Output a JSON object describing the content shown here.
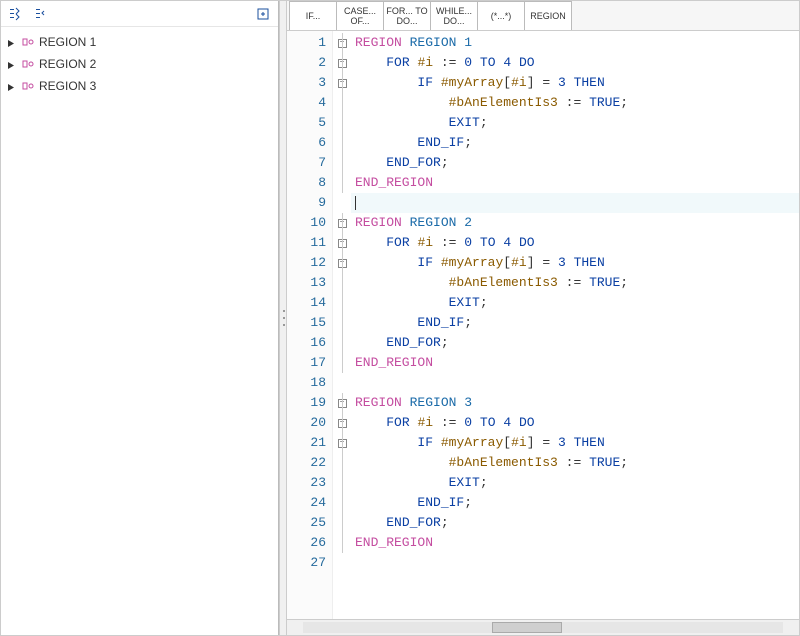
{
  "sidebar": {
    "items": [
      {
        "label": "REGION 1"
      },
      {
        "label": "REGION 2"
      },
      {
        "label": "REGION 3"
      }
    ]
  },
  "snippets": [
    {
      "label": "IF..."
    },
    {
      "label": "CASE... OF..."
    },
    {
      "label": "FOR... TO DO..."
    },
    {
      "label": "WHILE... DO..."
    },
    {
      "label": "(*...*)"
    },
    {
      "label": "REGION"
    }
  ],
  "code": {
    "lines": [
      {
        "n": 1,
        "fold": "open",
        "tokens": [
          [
            "kw-region",
            "REGION"
          ],
          [
            "sp",
            " "
          ],
          [
            "kw-name",
            "REGION 1"
          ]
        ]
      },
      {
        "n": 2,
        "fold": "open",
        "indent": 1,
        "tokens": [
          [
            "kw-ctrl",
            "FOR"
          ],
          [
            "sp",
            " "
          ],
          [
            "kw-var",
            "#i"
          ],
          [
            "sp",
            " "
          ],
          [
            "kw-assign",
            ":="
          ],
          [
            "sp",
            " "
          ],
          [
            "kw-num",
            "0"
          ],
          [
            "sp",
            " "
          ],
          [
            "kw-ctrl",
            "TO"
          ],
          [
            "sp",
            " "
          ],
          [
            "kw-num",
            "4"
          ],
          [
            "sp",
            " "
          ],
          [
            "kw-ctrl",
            "DO"
          ]
        ]
      },
      {
        "n": 3,
        "fold": "open",
        "indent": 2,
        "tokens": [
          [
            "kw-ctrl",
            "IF"
          ],
          [
            "sp",
            " "
          ],
          [
            "kw-var",
            "#myArray"
          ],
          [
            "kw-punc",
            "["
          ],
          [
            "kw-var",
            "#i"
          ],
          [
            "kw-punc",
            "]"
          ],
          [
            "sp",
            " "
          ],
          [
            "kw-assign",
            "="
          ],
          [
            "sp",
            " "
          ],
          [
            "kw-num",
            "3"
          ],
          [
            "sp",
            " "
          ],
          [
            "kw-ctrl",
            "THEN"
          ]
        ]
      },
      {
        "n": 4,
        "fold": "rail",
        "indent": 3,
        "tokens": [
          [
            "kw-var",
            "#bAnElementIs3"
          ],
          [
            "sp",
            " "
          ],
          [
            "kw-assign",
            ":="
          ],
          [
            "sp",
            " "
          ],
          [
            "kw-const",
            "TRUE"
          ],
          [
            "kw-punc",
            ";"
          ]
        ]
      },
      {
        "n": 5,
        "fold": "rail",
        "indent": 3,
        "tokens": [
          [
            "kw-ctrl",
            "EXIT"
          ],
          [
            "kw-punc",
            ";"
          ]
        ]
      },
      {
        "n": 6,
        "fold": "rail",
        "indent": 2,
        "tokens": [
          [
            "kw-ctrl",
            "END_IF"
          ],
          [
            "kw-punc",
            ";"
          ]
        ]
      },
      {
        "n": 7,
        "fold": "rail",
        "indent": 1,
        "tokens": [
          [
            "kw-ctrl",
            "END_FOR"
          ],
          [
            "kw-punc",
            ";"
          ]
        ]
      },
      {
        "n": 8,
        "fold": "rail",
        "indent": 0,
        "tokens": [
          [
            "kw-region",
            "END_REGION"
          ]
        ]
      },
      {
        "n": 9,
        "fold": "",
        "indent": 0,
        "caret": true,
        "tokens": []
      },
      {
        "n": 10,
        "fold": "open",
        "tokens": [
          [
            "kw-region",
            "REGION"
          ],
          [
            "sp",
            " "
          ],
          [
            "kw-name",
            "REGION 2"
          ]
        ]
      },
      {
        "n": 11,
        "fold": "open",
        "indent": 1,
        "tokens": [
          [
            "kw-ctrl",
            "FOR"
          ],
          [
            "sp",
            " "
          ],
          [
            "kw-var",
            "#i"
          ],
          [
            "sp",
            " "
          ],
          [
            "kw-assign",
            ":="
          ],
          [
            "sp",
            " "
          ],
          [
            "kw-num",
            "0"
          ],
          [
            "sp",
            " "
          ],
          [
            "kw-ctrl",
            "TO"
          ],
          [
            "sp",
            " "
          ],
          [
            "kw-num",
            "4"
          ],
          [
            "sp",
            " "
          ],
          [
            "kw-ctrl",
            "DO"
          ]
        ]
      },
      {
        "n": 12,
        "fold": "open",
        "indent": 2,
        "tokens": [
          [
            "kw-ctrl",
            "IF"
          ],
          [
            "sp",
            " "
          ],
          [
            "kw-var",
            "#myArray"
          ],
          [
            "kw-punc",
            "["
          ],
          [
            "kw-var",
            "#i"
          ],
          [
            "kw-punc",
            "]"
          ],
          [
            "sp",
            " "
          ],
          [
            "kw-assign",
            "="
          ],
          [
            "sp",
            " "
          ],
          [
            "kw-num",
            "3"
          ],
          [
            "sp",
            " "
          ],
          [
            "kw-ctrl",
            "THEN"
          ]
        ]
      },
      {
        "n": 13,
        "fold": "rail",
        "indent": 3,
        "tokens": [
          [
            "kw-var",
            "#bAnElementIs3"
          ],
          [
            "sp",
            " "
          ],
          [
            "kw-assign",
            ":="
          ],
          [
            "sp",
            " "
          ],
          [
            "kw-const",
            "TRUE"
          ],
          [
            "kw-punc",
            ";"
          ]
        ]
      },
      {
        "n": 14,
        "fold": "rail",
        "indent": 3,
        "tokens": [
          [
            "kw-ctrl",
            "EXIT"
          ],
          [
            "kw-punc",
            ";"
          ]
        ]
      },
      {
        "n": 15,
        "fold": "rail",
        "indent": 2,
        "tokens": [
          [
            "kw-ctrl",
            "END_IF"
          ],
          [
            "kw-punc",
            ";"
          ]
        ]
      },
      {
        "n": 16,
        "fold": "rail",
        "indent": 1,
        "tokens": [
          [
            "kw-ctrl",
            "END_FOR"
          ],
          [
            "kw-punc",
            ";"
          ]
        ]
      },
      {
        "n": 17,
        "fold": "rail",
        "indent": 0,
        "tokens": [
          [
            "kw-region",
            "END_REGION"
          ]
        ]
      },
      {
        "n": 18,
        "fold": "",
        "indent": 0,
        "tokens": []
      },
      {
        "n": 19,
        "fold": "open",
        "tokens": [
          [
            "kw-region",
            "REGION"
          ],
          [
            "sp",
            " "
          ],
          [
            "kw-name",
            "REGION 3"
          ]
        ]
      },
      {
        "n": 20,
        "fold": "open",
        "indent": 1,
        "tokens": [
          [
            "kw-ctrl",
            "FOR"
          ],
          [
            "sp",
            " "
          ],
          [
            "kw-var",
            "#i"
          ],
          [
            "sp",
            " "
          ],
          [
            "kw-assign",
            ":="
          ],
          [
            "sp",
            " "
          ],
          [
            "kw-num",
            "0"
          ],
          [
            "sp",
            " "
          ],
          [
            "kw-ctrl",
            "TO"
          ],
          [
            "sp",
            " "
          ],
          [
            "kw-num",
            "4"
          ],
          [
            "sp",
            " "
          ],
          [
            "kw-ctrl",
            "DO"
          ]
        ]
      },
      {
        "n": 21,
        "fold": "open",
        "indent": 2,
        "tokens": [
          [
            "kw-ctrl",
            "IF"
          ],
          [
            "sp",
            " "
          ],
          [
            "kw-var",
            "#myArray"
          ],
          [
            "kw-punc",
            "["
          ],
          [
            "kw-var",
            "#i"
          ],
          [
            "kw-punc",
            "]"
          ],
          [
            "sp",
            " "
          ],
          [
            "kw-assign",
            "="
          ],
          [
            "sp",
            " "
          ],
          [
            "kw-num",
            "3"
          ],
          [
            "sp",
            " "
          ],
          [
            "kw-ctrl",
            "THEN"
          ]
        ]
      },
      {
        "n": 22,
        "fold": "rail",
        "indent": 3,
        "tokens": [
          [
            "kw-var",
            "#bAnElementIs3"
          ],
          [
            "sp",
            " "
          ],
          [
            "kw-assign",
            ":="
          ],
          [
            "sp",
            " "
          ],
          [
            "kw-const",
            "TRUE"
          ],
          [
            "kw-punc",
            ";"
          ]
        ]
      },
      {
        "n": 23,
        "fold": "rail",
        "indent": 3,
        "tokens": [
          [
            "kw-ctrl",
            "EXIT"
          ],
          [
            "kw-punc",
            ";"
          ]
        ]
      },
      {
        "n": 24,
        "fold": "rail",
        "indent": 2,
        "tokens": [
          [
            "kw-ctrl",
            "END_IF"
          ],
          [
            "kw-punc",
            ";"
          ]
        ]
      },
      {
        "n": 25,
        "fold": "rail",
        "indent": 1,
        "tokens": [
          [
            "kw-ctrl",
            "END_FOR"
          ],
          [
            "kw-punc",
            ";"
          ]
        ]
      },
      {
        "n": 26,
        "fold": "rail",
        "indent": 0,
        "tokens": [
          [
            "kw-region",
            "END_REGION"
          ]
        ]
      },
      {
        "n": 27,
        "fold": "",
        "indent": 0,
        "tokens": []
      }
    ]
  }
}
